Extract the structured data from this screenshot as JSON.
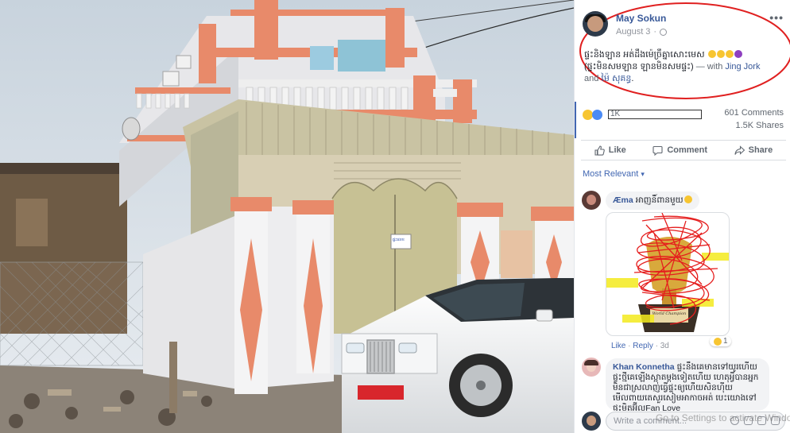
{
  "post": {
    "author": "May Sokun",
    "date": "August 3",
    "date_separator": "·",
    "more_label": "•••",
    "text_main": "ផ្ទះនិងឡាន អត់ដឹងម៉េច្រឹគ្នាសោះមេស",
    "text_second": "(ផ្ទះមិនសមឡាន ឡានមិនសមផ្ទះ)",
    "with_prefix": " — with ",
    "tag1": "Jing Jork",
    "and_word": " and ",
    "tag2": "ម៉ៃ សុគន្ធ",
    "period": "."
  },
  "stats": {
    "reaction_count": "1K",
    "comments": "601 Comments",
    "shares": "1.5K Shares"
  },
  "actions": {
    "like": "Like",
    "comment": "Comment",
    "share": "Share"
  },
  "sort": {
    "label": "Most Relevant",
    "caret": "▾"
  },
  "comments": [
    {
      "name": "Æma",
      "text": "អាញនិ៍ពានមួយ",
      "like": "Like",
      "reply": "Reply",
      "sep": "·",
      "time": "3d",
      "reactions": "1"
    },
    {
      "name": "Khan Konnetha",
      "text": "ផ្ទះនឹងគេមានទៅយូរហើយ ផ្ទះថ្មីគេឡើងស្អាតម្ដងទៀតហើយ ហេតុអ្វីបានអ្នកមិនជាស្រលាញ់ធ្វើផ្ទះឲ្យហើយសិនហ៊ីយ មើលពាយតេសួរសៀមអាកាចអត់ បេះយោងទៅផ្ទះមិតអ៊ីលFan Love"
    }
  ],
  "write": {
    "placeholder": "Write a comment..."
  },
  "watermark": "Go to Settings to activate Windows.",
  "sticker_caption": "World Champion",
  "photo": {
    "door_sign": "ផ្ទះលេខ"
  },
  "colors": {
    "link": "#385898",
    "facebook_blue": "#4267b2",
    "annotation_red": "#e02020",
    "house_salmon": "#e88a6a",
    "gate_olive": "#c7c194"
  }
}
